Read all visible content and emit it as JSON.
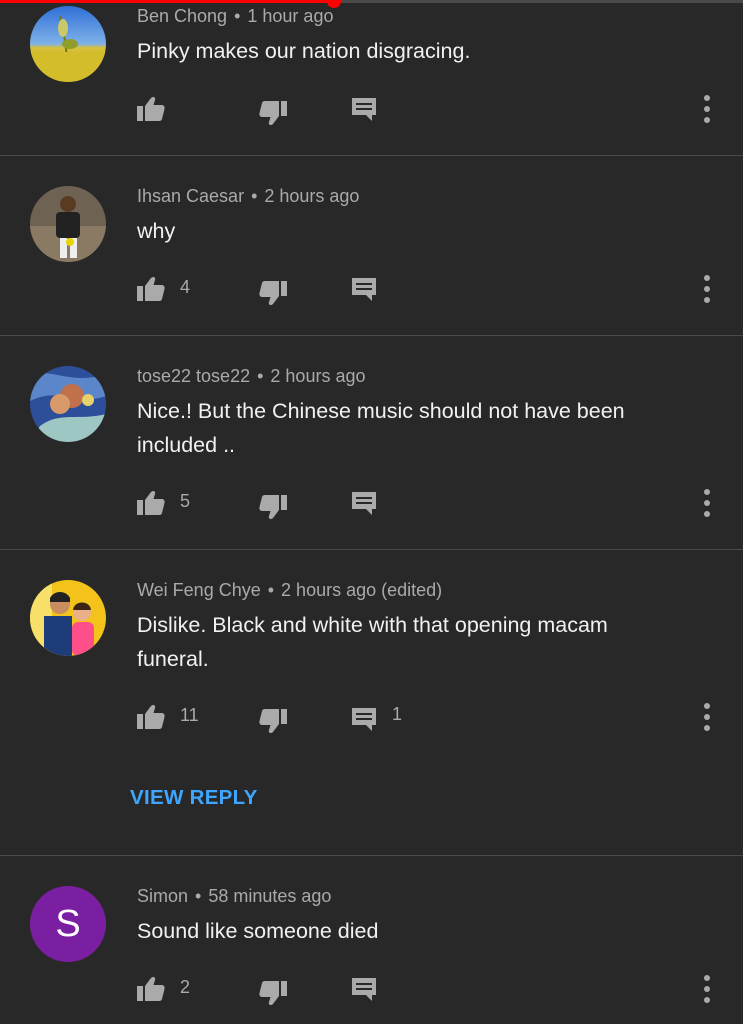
{
  "playback": {
    "progress_fraction": 0.45,
    "accent_color": "#ff0000"
  },
  "comments": [
    {
      "author": "Ben Chong",
      "time": "1 hour ago",
      "text": "Pinky makes our nation disgracing.",
      "likes": "",
      "replies": ""
    },
    {
      "author": "Ihsan Caesar",
      "time": "2 hours ago",
      "text": "why",
      "likes": "4",
      "replies": ""
    },
    {
      "author": "tose22 tose22",
      "time": "2 hours ago",
      "text": "Nice.! But the Chinese music should not have been included ..",
      "likes": "5",
      "replies": ""
    },
    {
      "author": "Wei Feng Chye",
      "time": "2 hours ago (edited)",
      "text": "Dislike. Black and white with that opening macam funeral.",
      "likes": "11",
      "replies": "1",
      "view_reply_label": "VIEW REPLY"
    },
    {
      "author": "Simon",
      "time": "58 minutes ago",
      "text": "Sound like someone died",
      "likes": "2",
      "replies": "",
      "avatar_letter": "S",
      "avatar_color": "#7b1fa2"
    }
  ],
  "separator": "•"
}
